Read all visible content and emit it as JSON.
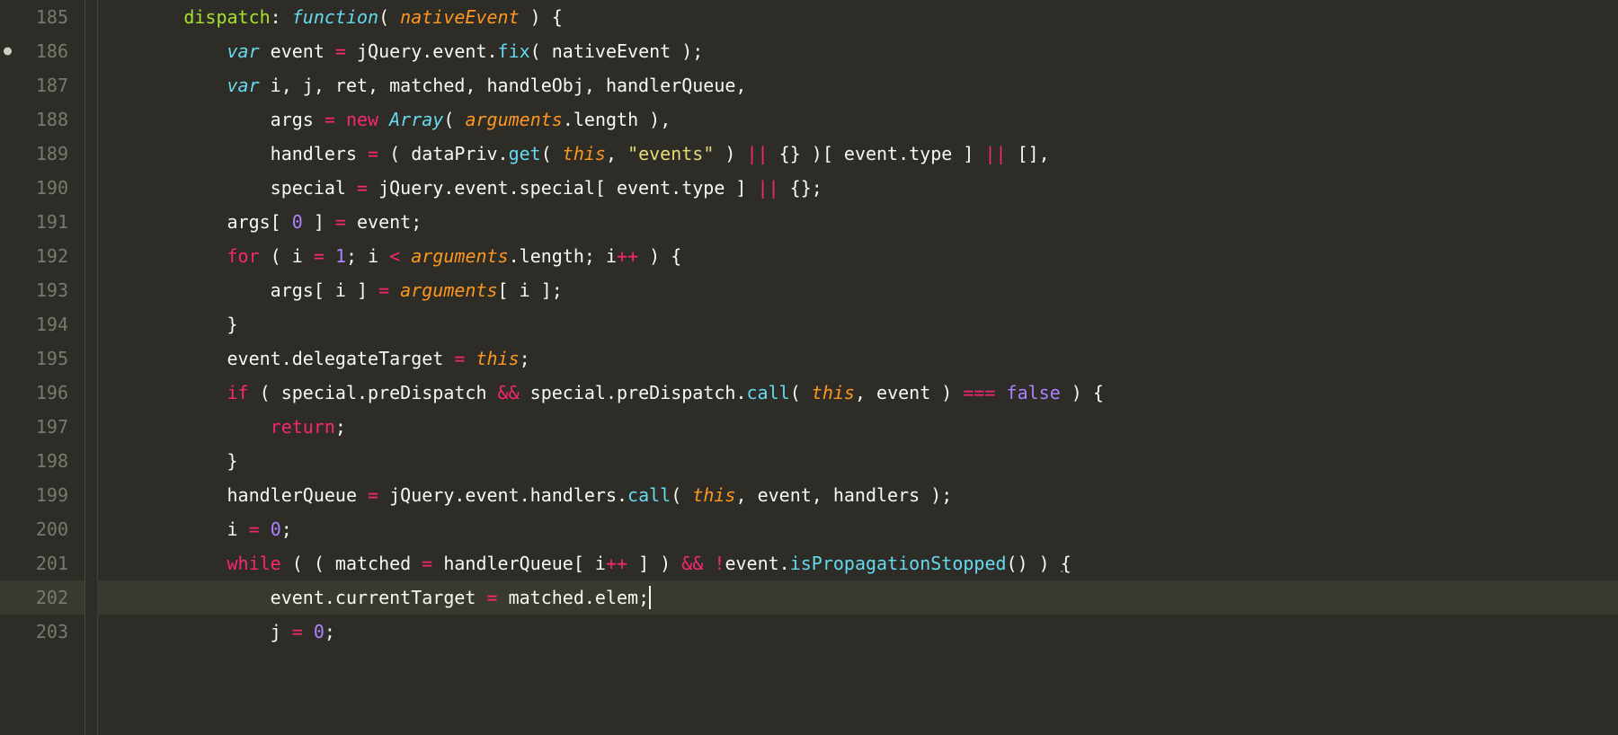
{
  "startLine": 185,
  "modifiedLine": 186,
  "currentLine": 202,
  "lines": [
    {
      "n": 185,
      "indent": 2,
      "tokens": [
        [
          "name",
          "dispatch"
        ],
        [
          "punct",
          ": "
        ],
        [
          "fn",
          "function"
        ],
        [
          "punct",
          "( "
        ],
        [
          "param",
          "nativeEvent"
        ],
        [
          "punct",
          " ) {"
        ]
      ]
    },
    {
      "n": 186,
      "indent": 3,
      "tokens": [
        [
          "var",
          "var"
        ],
        [
          "plain",
          " event "
        ],
        [
          "op",
          "="
        ],
        [
          "plain",
          " jQuery.event."
        ],
        [
          "call",
          "fix"
        ],
        [
          "punct",
          "( nativeEvent );"
        ]
      ]
    },
    {
      "n": 187,
      "indent": 3,
      "tokens": [
        [
          "var",
          "var"
        ],
        [
          "plain",
          " i, j, ret, matched, handleObj, handlerQueue,"
        ]
      ]
    },
    {
      "n": 188,
      "indent": 4,
      "tokens": [
        [
          "plain",
          "args "
        ],
        [
          "op",
          "="
        ],
        [
          "plain",
          " "
        ],
        [
          "kwred",
          "new"
        ],
        [
          "plain",
          " "
        ],
        [
          "fn",
          "Array"
        ],
        [
          "punct",
          "( "
        ],
        [
          "param",
          "arguments"
        ],
        [
          "punct",
          ".length ),"
        ]
      ]
    },
    {
      "n": 189,
      "indent": 4,
      "tokens": [
        [
          "plain",
          "handlers "
        ],
        [
          "op",
          "="
        ],
        [
          "plain",
          " ( dataPriv."
        ],
        [
          "call",
          "get"
        ],
        [
          "punct",
          "( "
        ],
        [
          "param",
          "this"
        ],
        [
          "punct",
          ", "
        ],
        [
          "str",
          "\"events\""
        ],
        [
          "punct",
          " ) "
        ],
        [
          "op",
          "||"
        ],
        [
          "punct",
          " {} )[ event.type ] "
        ],
        [
          "op",
          "||"
        ],
        [
          "punct",
          " [],"
        ]
      ]
    },
    {
      "n": 190,
      "indent": 4,
      "tokens": [
        [
          "plain",
          "special "
        ],
        [
          "op",
          "="
        ],
        [
          "plain",
          " jQuery.event.special[ event.type ] "
        ],
        [
          "op",
          "||"
        ],
        [
          "plain",
          " {};"
        ]
      ]
    },
    {
      "n": 191,
      "indent": 3,
      "tokens": [
        [
          "plain",
          "args[ "
        ],
        [
          "num",
          "0"
        ],
        [
          "plain",
          " ] "
        ],
        [
          "op",
          "="
        ],
        [
          "plain",
          " event;"
        ]
      ]
    },
    {
      "n": 192,
      "indent": 3,
      "tokens": [
        [
          "kwred",
          "for"
        ],
        [
          "plain",
          " ( i "
        ],
        [
          "op",
          "="
        ],
        [
          "plain",
          " "
        ],
        [
          "num",
          "1"
        ],
        [
          "plain",
          "; i "
        ],
        [
          "op",
          "<"
        ],
        [
          "plain",
          " "
        ],
        [
          "param",
          "arguments"
        ],
        [
          "plain",
          ".length; i"
        ],
        [
          "op",
          "++"
        ],
        [
          "plain",
          " ) {"
        ]
      ]
    },
    {
      "n": 193,
      "indent": 4,
      "tokens": [
        [
          "plain",
          "args[ i ] "
        ],
        [
          "op",
          "="
        ],
        [
          "plain",
          " "
        ],
        [
          "param",
          "arguments"
        ],
        [
          "plain",
          "[ i ];"
        ]
      ]
    },
    {
      "n": 194,
      "indent": 3,
      "tokens": [
        [
          "plain",
          "}"
        ]
      ]
    },
    {
      "n": 195,
      "indent": 3,
      "tokens": [
        [
          "plain",
          "event.delegateTarget "
        ],
        [
          "op",
          "="
        ],
        [
          "plain",
          " "
        ],
        [
          "param",
          "this"
        ],
        [
          "plain",
          ";"
        ]
      ]
    },
    {
      "n": 196,
      "indent": 3,
      "tokens": [
        [
          "kwred",
          "if"
        ],
        [
          "plain",
          " ( special.preDispatch "
        ],
        [
          "op",
          "&&"
        ],
        [
          "plain",
          " special.preDispatch."
        ],
        [
          "call",
          "call"
        ],
        [
          "punct",
          "( "
        ],
        [
          "param",
          "this"
        ],
        [
          "punct",
          ", event ) "
        ],
        [
          "op",
          "==="
        ],
        [
          "plain",
          " "
        ],
        [
          "bool",
          "false"
        ],
        [
          "plain",
          " ) {"
        ]
      ]
    },
    {
      "n": 197,
      "indent": 4,
      "tokens": [
        [
          "kwred",
          "return"
        ],
        [
          "plain",
          ";"
        ]
      ]
    },
    {
      "n": 198,
      "indent": 3,
      "tokens": [
        [
          "plain",
          "}"
        ]
      ]
    },
    {
      "n": 199,
      "indent": 3,
      "tokens": [
        [
          "plain",
          "handlerQueue "
        ],
        [
          "op",
          "="
        ],
        [
          "plain",
          " jQuery.event.handlers."
        ],
        [
          "call",
          "call"
        ],
        [
          "punct",
          "( "
        ],
        [
          "param",
          "this"
        ],
        [
          "punct",
          ", event, handlers );"
        ]
      ]
    },
    {
      "n": 200,
      "indent": 3,
      "tokens": [
        [
          "plain",
          "i "
        ],
        [
          "op",
          "="
        ],
        [
          "plain",
          " "
        ],
        [
          "num",
          "0"
        ],
        [
          "plain",
          ";"
        ]
      ]
    },
    {
      "n": 201,
      "indent": 3,
      "tokens": [
        [
          "kwred",
          "while"
        ],
        [
          "plain",
          " ( ( matched "
        ],
        [
          "op",
          "="
        ],
        [
          "plain",
          " handlerQueue[ i"
        ],
        [
          "op",
          "++"
        ],
        [
          "plain",
          " ] ) "
        ],
        [
          "op",
          "&&"
        ],
        [
          "plain",
          " "
        ],
        [
          "op",
          "!"
        ],
        [
          "plain",
          "event."
        ],
        [
          "call",
          "isPropagationStopped"
        ],
        [
          "plain",
          "() ) "
        ],
        [
          "under",
          "{"
        ]
      ]
    },
    {
      "n": 202,
      "indent": 4,
      "tokens": [
        [
          "plain",
          "event.currentTarget "
        ],
        [
          "op",
          "="
        ],
        [
          "plain",
          " matched.elem;"
        ],
        [
          "cursor",
          ""
        ]
      ]
    },
    {
      "n": 203,
      "indent": 4,
      "tokens": [
        [
          "plain",
          "j "
        ],
        [
          "op",
          "="
        ],
        [
          "plain",
          " "
        ],
        [
          "num",
          "0"
        ],
        [
          "plain",
          ";"
        ]
      ]
    }
  ],
  "tokenClassMap": {
    "fn": "c-fn",
    "kw": "c-kw",
    "kwred": "c-kwred",
    "var": "c-var",
    "param": "c-param",
    "call": "c-call",
    "name": "c-name",
    "op": "c-op",
    "num": "c-num",
    "str": "c-str",
    "bool": "c-bool",
    "plain": "c-plain",
    "punct": "c-punct",
    "cursor": "c-cursor",
    "under": "c-under c-plain"
  },
  "indentUnit": "    "
}
